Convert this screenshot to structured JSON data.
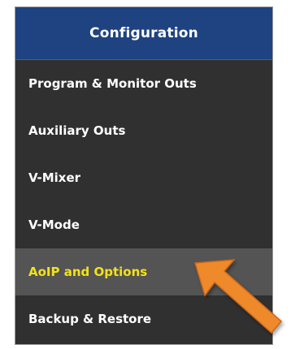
{
  "menu": {
    "title": "Configuration",
    "items": [
      {
        "label": "Program & Monitor Outs",
        "active": false
      },
      {
        "label": "Auxiliary Outs",
        "active": false
      },
      {
        "label": "V-Mixer",
        "active": false
      },
      {
        "label": "V-Mode",
        "active": false
      },
      {
        "label": "AoIP and Options",
        "active": true
      },
      {
        "label": "Backup & Restore",
        "active": false
      }
    ]
  },
  "colors": {
    "header_bg": "#1e4380",
    "menu_bg": "#303030",
    "active_bg": "#545454",
    "active_text": "#f3e21b",
    "arrow": "#ee8a2c"
  }
}
